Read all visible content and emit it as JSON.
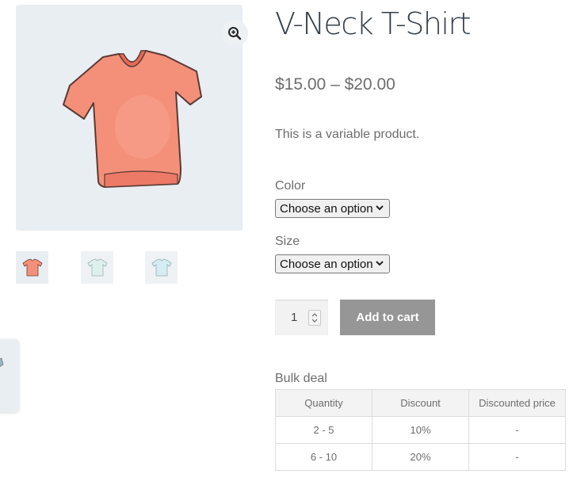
{
  "product": {
    "title": "V-Neck T-Shirt",
    "price": "$15.00 – $20.00",
    "description": "This is a variable product."
  },
  "gallery": {
    "main_image": "salmon-v-neck-tshirt",
    "zoom_icon": "zoom-in-icon",
    "thumbnails": [
      "salmon-tshirt",
      "mint-tshirt",
      "light-blue-tshirt"
    ]
  },
  "variations": {
    "color": {
      "label": "Color",
      "selected": "Choose an option"
    },
    "size": {
      "label": "Size",
      "selected": "Choose an option"
    }
  },
  "cart": {
    "quantity": "1",
    "add_label": "Add to cart"
  },
  "bulk_deal": {
    "label": "Bulk deal",
    "headers": [
      "Quantity",
      "Discount",
      "Discounted price"
    ],
    "rows": [
      [
        "2 - 5",
        "10%",
        "-"
      ],
      [
        "6 - 10",
        "20%",
        "-"
      ]
    ]
  },
  "colors": {
    "title": "#333e48",
    "text": "#6d6d6d",
    "button": "#969696",
    "image_bg": "#e9eef2",
    "shirt": "#f4907a"
  }
}
